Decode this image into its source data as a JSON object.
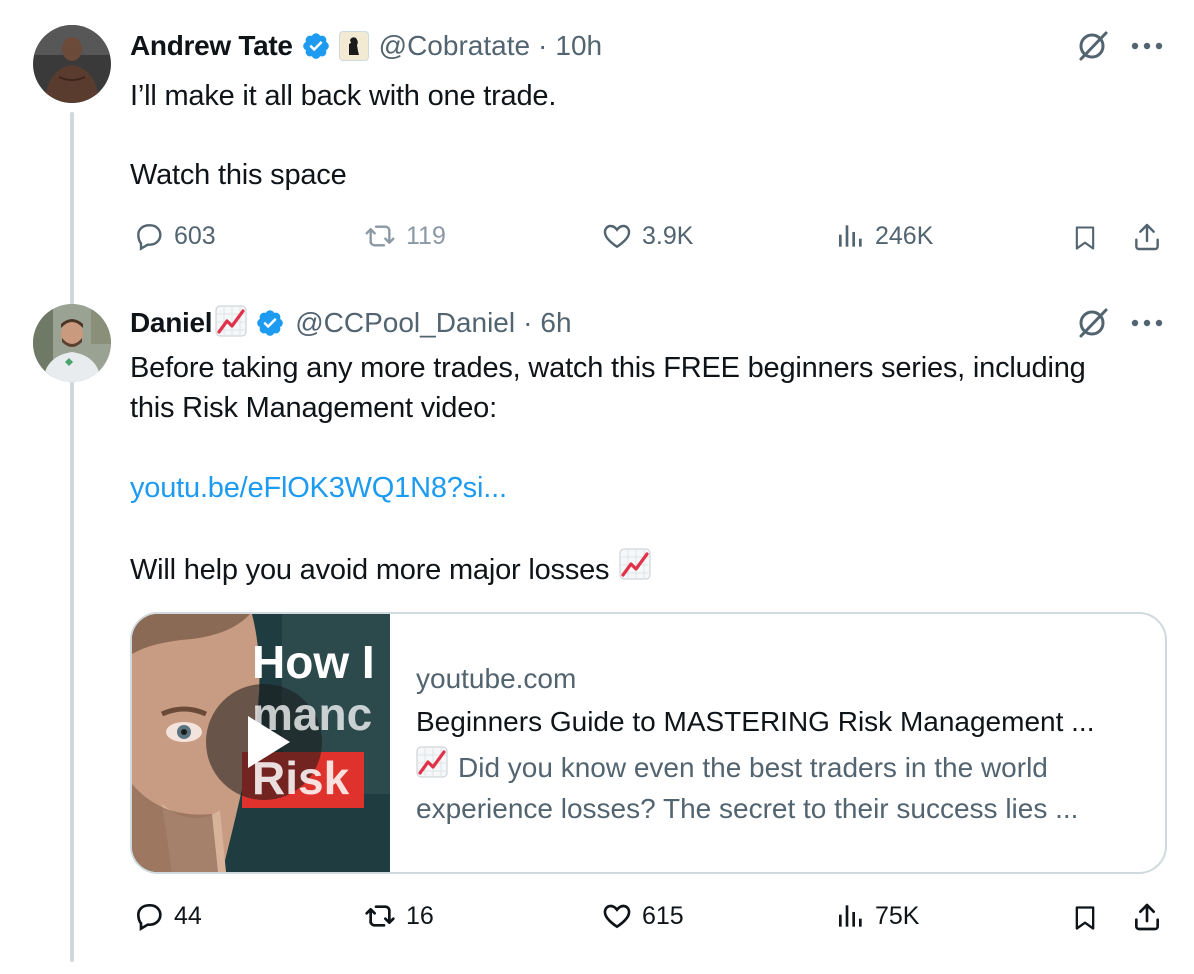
{
  "tweets": [
    {
      "name": "Andrew Tate",
      "handle": "@Cobratate",
      "separator": "·",
      "time": "10h",
      "lines": [
        "I’ll make it all back with one trade.",
        "Watch this space"
      ],
      "stats": {
        "replies": "603",
        "reposts": "119",
        "likes": "3.9K",
        "views": "246K"
      }
    },
    {
      "name": "Daniel",
      "handle": "@CCPool_Daniel",
      "separator": "·",
      "time": "6h",
      "line1": "Before taking any more trades, watch this FREE beginners series, including",
      "line2": "this Risk Management video:",
      "link": "youtu.be/eFlOK3WQ1N8?si...",
      "line3": "Will help you avoid more major losses",
      "card": {
        "domain": "youtube.com",
        "title": "Beginners Guide to MASTERING Risk Management ...",
        "desc1": "Did you know even the best traders in the world",
        "desc2": "experience losses? The secret to their success lies ...",
        "thumb_text1": "How I",
        "thumb_text2": "manc",
        "thumb_text3": "Risk"
      },
      "stats": {
        "replies": "44",
        "reposts": "16",
        "likes": "615",
        "views": "75K"
      }
    }
  ],
  "icons": [
    "grok-icon",
    "more-icon",
    "reply-icon",
    "repost-icon",
    "like-icon",
    "views-icon",
    "bookmark-icon",
    "share-icon",
    "verified-badge-icon",
    "chart-increasing-emoji"
  ],
  "colors": {
    "link": "#1d9bf0",
    "muted": "#536471",
    "text": "#0f1419",
    "line": "#cfd9de"
  }
}
